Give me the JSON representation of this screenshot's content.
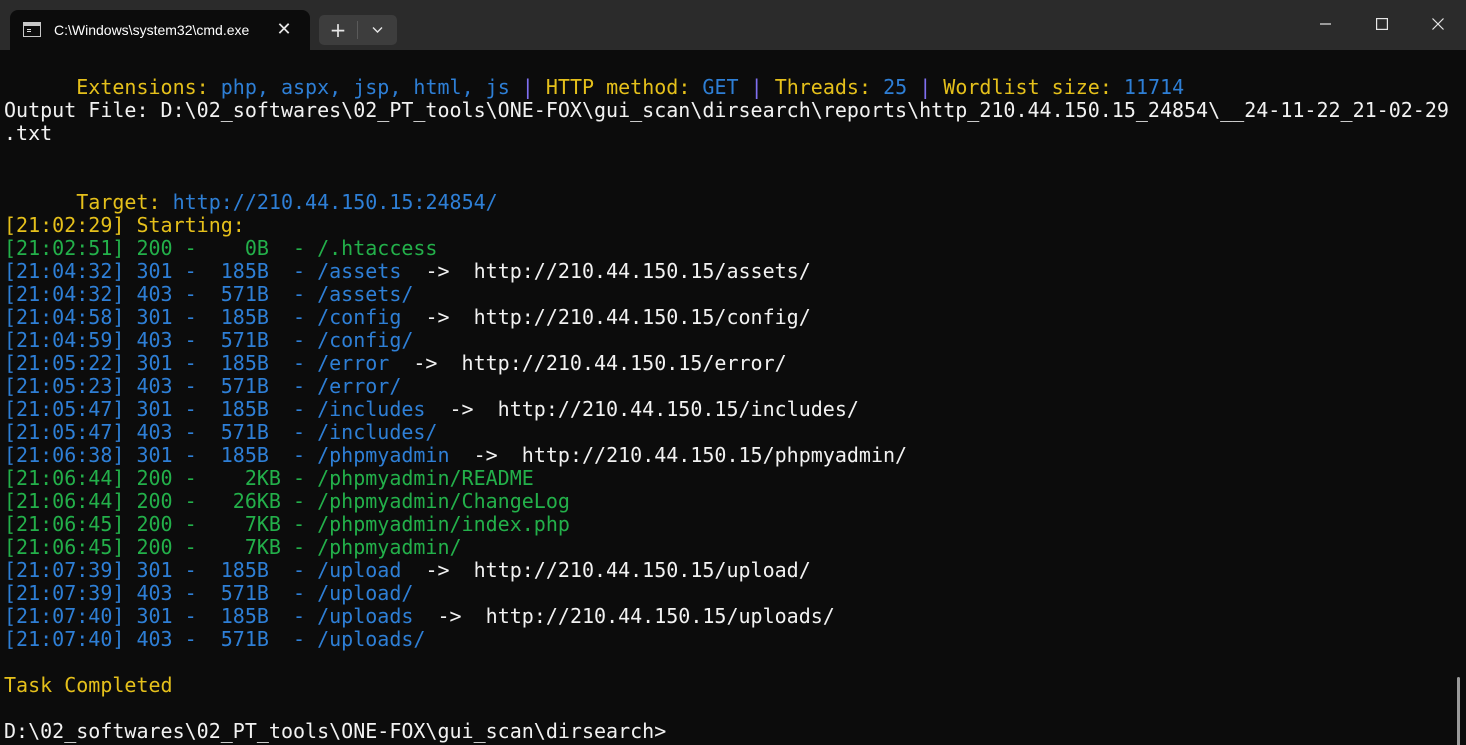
{
  "tab": {
    "title": "C:\\Windows\\system32\\cmd.exe",
    "icon": "terminal-icon",
    "close_icon": "close-icon"
  },
  "toolbar": {
    "new_tab_label": "+",
    "new_tab_icon": "plus-icon",
    "dropdown_icon": "chevron-down-icon"
  },
  "window_controls": [
    "minimize-icon",
    "maximize-icon",
    "close-icon"
  ],
  "colors": {
    "background": "#0c0c0c",
    "titlebar": "#2b2b2b",
    "yellow": "#e5c01b",
    "blue": "#3a96dd",
    "green": "#23b04a",
    "white": "#f2f2f2"
  },
  "terminal": {
    "config": {
      "ext_label": "Extensions:",
      "ext_value": "php, aspx, jsp, html, js",
      "sep1": "|",
      "method_label": "HTTP method:",
      "method_value": "GET",
      "sep2": "|",
      "threads_label": "Threads:",
      "threads_value": "25",
      "sep3": "|",
      "wordlist_label": "Wordlist size:",
      "wordlist_value": "11714"
    },
    "output_file_line1": "Output File: D:\\02_softwares\\02_PT_tools\\ONE-FOX\\gui_scan\\dirsearch\\reports\\http_210.44.150.15_24854\\__24-11-22_21-02-29",
    "output_file_line2": ".txt",
    "target_label": "Target:",
    "target_value": "http://210.44.150.15:24854/",
    "starting": "[21:02:29] Starting:",
    "results": [
      {
        "text": "[21:02:51] 200 -    0B  - /.htaccess",
        "redirect": ""
      },
      {
        "text": "[21:04:32] 301 -  185B  - /assets",
        "redirect": "  ->  http://210.44.150.15/assets/"
      },
      {
        "text": "[21:04:32] 403 -  571B  - /assets/",
        "redirect": ""
      },
      {
        "text": "[21:04:58] 301 -  185B  - /config",
        "redirect": "  ->  http://210.44.150.15/config/"
      },
      {
        "text": "[21:04:59] 403 -  571B  - /config/",
        "redirect": ""
      },
      {
        "text": "[21:05:22] 301 -  185B  - /error",
        "redirect": "  ->  http://210.44.150.15/error/"
      },
      {
        "text": "[21:05:23] 403 -  571B  - /error/",
        "redirect": ""
      },
      {
        "text": "[21:05:47] 301 -  185B  - /includes",
        "redirect": "  ->  http://210.44.150.15/includes/"
      },
      {
        "text": "[21:05:47] 403 -  571B  - /includes/",
        "redirect": ""
      },
      {
        "text": "[21:06:38] 301 -  185B  - /phpmyadmin",
        "redirect": "  ->  http://210.44.150.15/phpmyadmin/"
      },
      {
        "text": "[21:06:44] 200 -    2KB - /phpmyadmin/README",
        "redirect": ""
      },
      {
        "text": "[21:06:44] 200 -   26KB - /phpmyadmin/ChangeLog",
        "redirect": ""
      },
      {
        "text": "[21:06:45] 200 -    7KB - /phpmyadmin/index.php",
        "redirect": ""
      },
      {
        "text": "[21:06:45] 200 -    7KB - /phpmyadmin/",
        "redirect": ""
      },
      {
        "text": "[21:07:39] 301 -  185B  - /upload",
        "redirect": "  ->  http://210.44.150.15/upload/"
      },
      {
        "text": "[21:07:39] 403 -  571B  - /upload/",
        "redirect": ""
      },
      {
        "text": "[21:07:40] 301 -  185B  - /uploads",
        "redirect": "  ->  http://210.44.150.15/uploads/"
      },
      {
        "text": "[21:07:40] 403 -  571B  - /uploads/",
        "redirect": ""
      }
    ],
    "task_completed": "Task Completed",
    "prompt": "D:\\02_softwares\\02_PT_tools\\ONE-FOX\\gui_scan\\dirsearch>"
  }
}
